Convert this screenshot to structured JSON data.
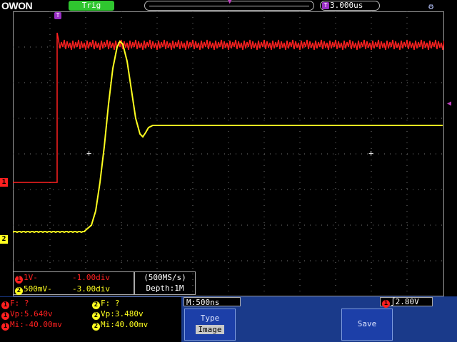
{
  "topbar": {
    "logo": "OWON",
    "trigger_status": "Trig",
    "time_offset": "3.000us",
    "trigger_badge": "T"
  },
  "channels": {
    "ch1": {
      "id": "1",
      "probe": "1V-",
      "offset": "-1.00div",
      "color": "#ff2020"
    },
    "ch2": {
      "id": "2",
      "probe": "500mV-",
      "offset": "-3.00div",
      "color": "#ffff20"
    }
  },
  "acquisition": {
    "sample_rate": "(500MS/s)",
    "depth": "Depth:1M"
  },
  "measurements": {
    "ch1": {
      "freq": "F:  ?",
      "vp": "Vp:5.640v",
      "mi": "Mi:-40.00mv"
    },
    "ch2": {
      "freq": "F:  ?",
      "vp": "Vp:3.480v",
      "mi": "Mi:40.00mv"
    }
  },
  "timebase": "M:500ns",
  "trigger": {
    "source": "1",
    "level": "2.80V"
  },
  "menu": {
    "type_label": "Type",
    "type_value": "Image",
    "save_label": "Save"
  },
  "colors": {
    "ch1": "#ff2020",
    "ch2": "#ffff20",
    "grid": "#9a9a9a",
    "trigger_marker": "#9b2fc6",
    "menu_blue": "#1c3fa8"
  },
  "icons": {
    "scope": "oscilloscope-icon",
    "trigger_edge": "rising-edge-icon"
  }
}
